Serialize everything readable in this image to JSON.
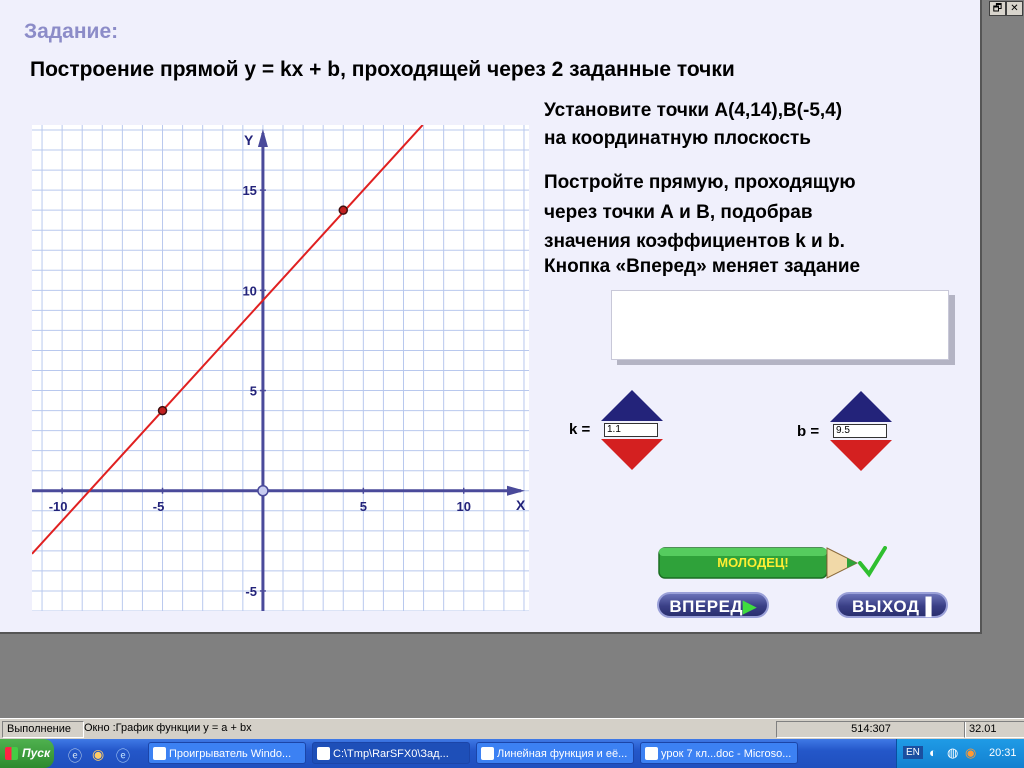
{
  "app": {
    "task_label": "Задание:",
    "task_title": "Построение прямой y = kx + b, проходящей через 2 заданные точки",
    "instructions": [
      "Установите точки А(4,14),В(-5,4)",
      "на координатную плоскость",
      "Постройте прямую, проходящую",
      "через точки А и В, подобрав",
      "значения коэффициентов k и b.",
      "Кнопка «Вперед» меняет задание"
    ],
    "answer_box_text": "",
    "k_label": "k =",
    "k_value": "1.1",
    "b_label": "b =",
    "b_value": "9.5",
    "pencil_text": "МОЛОДЕЦ!",
    "forward_button": "ВПЕРЕД",
    "exit_button": "ВЫХОД",
    "accent_colors": {
      "spinner_up": "#23237a",
      "spinner_down": "#d42020",
      "line": "#e02020",
      "check": "#2fbf2f"
    }
  },
  "graph": {
    "y_axis_label": "Y",
    "x_axis_label": "X",
    "x_ticks": [
      "-10",
      "-5",
      "5",
      "10"
    ],
    "y_ticks": [
      "15",
      "10",
      "5",
      "-5"
    ],
    "line": {
      "k": 1.1,
      "b": 9.5
    },
    "points": [
      {
        "x": 4,
        "y": 14
      },
      {
        "x": -5,
        "y": 4
      }
    ],
    "origin_marker": {
      "x": 0,
      "y": 0
    },
    "x_range": [
      -11.5,
      13.25
    ],
    "y_range": [
      -6,
      18.25
    ]
  },
  "statusbar": {
    "mode": "Выполнение",
    "window_text": "Окно :График функции y = a + bx",
    "coords": "514:307",
    "version": "32.01"
  },
  "taskbar": {
    "start_label": "Пуск",
    "tasks": [
      {
        "label": "Проигрыватель Windo...",
        "active": false
      },
      {
        "label": "C:\\Tmp\\RarSFX0\\Зад...",
        "active": true
      },
      {
        "label": "Линейная функция и её...",
        "active": false
      },
      {
        "label": "урок 7 кл...doc - Microso...",
        "active": false
      }
    ],
    "lang": "EN",
    "clock": "20:31"
  },
  "window_controls": {
    "restore": "🗗",
    "close": "✕"
  }
}
